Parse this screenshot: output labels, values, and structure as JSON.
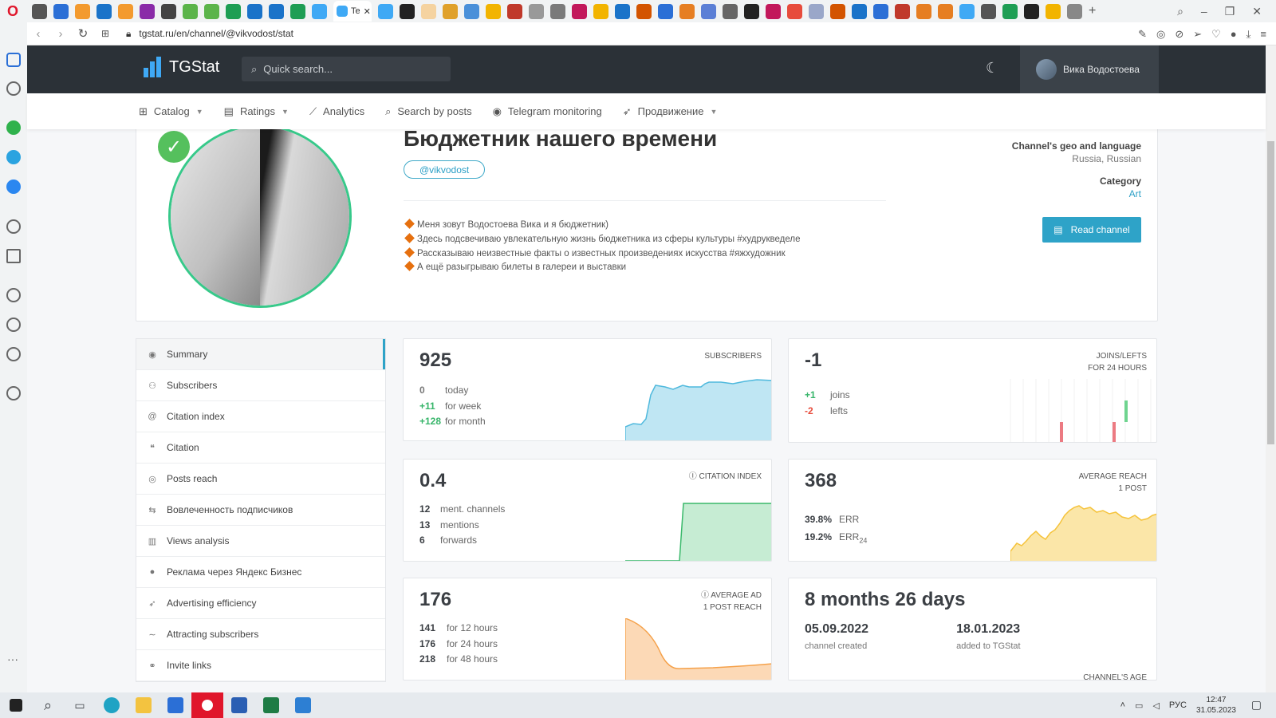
{
  "browser": {
    "address": "tgstat.ru/en/channel/@vikvodost/stat",
    "active_tab_label": "Te"
  },
  "site": {
    "logo_text": "TGStat",
    "search_placeholder": "Quick search...",
    "user_name": "Вика Водостоева"
  },
  "nav": [
    {
      "label": "Catalog",
      "icon": "grid-icon",
      "dropdown": true
    },
    {
      "label": "Ratings",
      "icon": "ratings-icon",
      "dropdown": true
    },
    {
      "label": "Analytics",
      "icon": "chart-icon",
      "dropdown": false
    },
    {
      "label": "Search by posts",
      "icon": "search-icon",
      "dropdown": false
    },
    {
      "label": "Telegram monitoring",
      "icon": "monitor-icon",
      "dropdown": false
    },
    {
      "label": "Продвижение",
      "icon": "rocket-icon",
      "dropdown": true
    }
  ],
  "channel": {
    "title": "Бюджетник нашего времени",
    "handle": "@vikvodost",
    "description": [
      "Меня зовут Водостоева Вика и я бюджетник)",
      "Здесь подсвечиваю увлекательную жизнь бюджетника из сферы культуры #худрукведеле",
      "Рассказываю неизвестные факты о известных произведениях искусства #яжхудожник",
      "А ещё разыгрываю билеты в галереи и выставки"
    ],
    "geo_label": "Channel's geo and language",
    "geo_value": "Russia, Russian",
    "category_label": "Category",
    "category_value": "Art",
    "read_button": "Read channel"
  },
  "menu": [
    {
      "label": "Summary",
      "icon": "summary-icon",
      "active": true
    },
    {
      "label": "Subscribers",
      "icon": "users-icon",
      "active": false
    },
    {
      "label": "Citation index",
      "icon": "at-icon",
      "active": false
    },
    {
      "label": "Citation",
      "icon": "quote-icon",
      "active": false
    },
    {
      "label": "Posts reach",
      "icon": "eye-icon",
      "active": false
    },
    {
      "label": "Вовлеченность подписчиков",
      "icon": "engagement-icon",
      "active": false
    },
    {
      "label": "Views analysis",
      "icon": "bar-chart-icon",
      "active": false
    },
    {
      "label": "Реклама через Яндекс Бизнес",
      "icon": "yandex-icon",
      "active": false
    },
    {
      "label": "Advertising efficiency",
      "icon": "rocket-icon",
      "active": false
    },
    {
      "label": "Attracting subscribers",
      "icon": "trend-icon",
      "active": false
    },
    {
      "label": "Invite links",
      "icon": "link-icon",
      "active": false
    }
  ],
  "cards": {
    "subscribers": {
      "value": "925",
      "caption": "SUBSCRIBERS",
      "rows": [
        {
          "n": "0",
          "label": "today",
          "tone": "neutral"
        },
        {
          "n": "+11",
          "label": "for week",
          "tone": "pos"
        },
        {
          "n": "+128",
          "label": "for month",
          "tone": "pos"
        }
      ]
    },
    "joins": {
      "value": "-1",
      "caption_line1": "JOINS/LEFTS",
      "caption_line2": "FOR 24 HOURS",
      "rows": [
        {
          "n": "+1",
          "label": "joins",
          "tone": "pos"
        },
        {
          "n": "-2",
          "label": "lefts",
          "tone": "neg"
        }
      ]
    },
    "citation": {
      "value": "0.4",
      "caption": "CITATION INDEX",
      "rows": [
        {
          "n": "12",
          "label": "ment. channels",
          "tone": "default"
        },
        {
          "n": "13",
          "label": "mentions",
          "tone": "default"
        },
        {
          "n": "6",
          "label": "forwards",
          "tone": "default"
        }
      ]
    },
    "reach": {
      "value": "368",
      "caption_line1": "AVERAGE REACH",
      "caption_line2": "1 POST",
      "err_value": "39.8%",
      "err_label": "ERR",
      "err24_value": "19.2%",
      "err24_label": "ERR",
      "err24_sub": "24"
    },
    "ad_reach": {
      "value": "176",
      "caption_line1": "AVERAGE AD",
      "caption_line2": "1 POST REACH",
      "rows": [
        {
          "n": "141",
          "label": "for 12 hours",
          "tone": "default"
        },
        {
          "n": "176",
          "label": "for 24 hours",
          "tone": "default"
        },
        {
          "n": "218",
          "label": "for 48 hours",
          "tone": "default"
        }
      ]
    },
    "age": {
      "value": "8 months 26 days",
      "created_date": "05.09.2022",
      "created_label": "channel created",
      "added_date": "18.01.2023",
      "added_label": "added to TGStat",
      "caption": "CHANNEL'S AGE"
    }
  },
  "taskbar": {
    "lang": "РУС",
    "time": "12:47",
    "date": "31.05.2023"
  },
  "colors": {
    "header_bg": "#2b3137",
    "accent": "#2ea3c8",
    "positive": "#37b56a",
    "negative": "#e74c3c",
    "subscribers_chart": "#4fb9dd",
    "citation_chart": "#3ab96b",
    "reach_chart": "#f5c33b",
    "ad_chart": "#f5a14a"
  }
}
